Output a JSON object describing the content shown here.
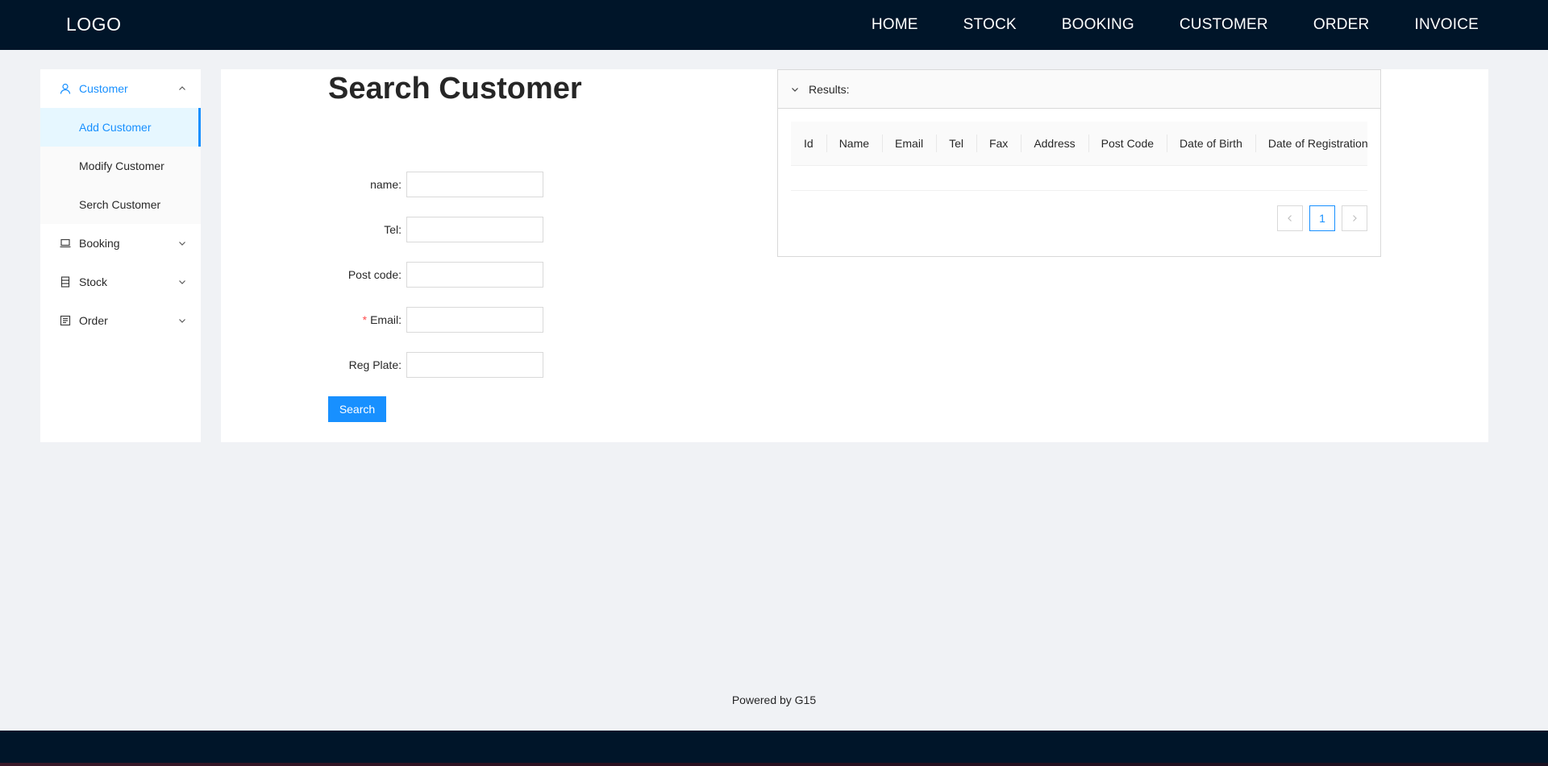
{
  "header": {
    "logo": "LOGO",
    "nav": [
      "HOME",
      "STOCK",
      "BOOKING",
      "CUSTOMER",
      "ORDER",
      "INVOICE"
    ]
  },
  "sidebar": {
    "customer": {
      "label": "Customer",
      "icon": "user-icon",
      "children": [
        "Add Customer",
        "Modify Customer",
        "Serch Customer"
      ]
    },
    "booking": {
      "label": "Booking",
      "icon": "laptop-icon"
    },
    "stock": {
      "label": "Stock",
      "icon": "database-icon"
    },
    "order": {
      "label": "Order",
      "icon": "profile-icon"
    }
  },
  "main": {
    "title": "Search Customer",
    "form": {
      "name_label": "name",
      "tel_label": "Tel",
      "postcode_label": "Post code",
      "email_label": "Email",
      "email_required": "*",
      "regplate_label": "Reg Plate",
      "name_value": "",
      "tel_value": "",
      "postcode_value": "",
      "email_value": "",
      "regplate_value": ""
    },
    "search_button": "Search"
  },
  "results": {
    "title": "Results:",
    "columns": [
      "Id",
      "Name",
      "Email",
      "Tel",
      "Fax",
      "Address",
      "Post Code",
      "Date of Birth",
      "Date of Registration"
    ],
    "rows": [],
    "pagination": {
      "current": "1"
    }
  },
  "footer": {
    "text": "Powered by G15"
  },
  "colors": {
    "header_bg": "#001529",
    "accent": "#1890ff",
    "required": "#ff4d4f",
    "page_bg": "#f0f2f5"
  }
}
